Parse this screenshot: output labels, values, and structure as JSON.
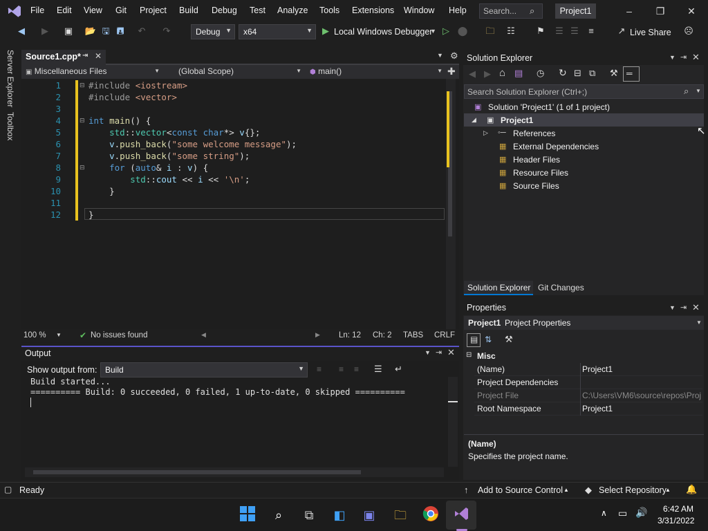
{
  "menu": {
    "items": [
      "File",
      "Edit",
      "View",
      "Git",
      "Project",
      "Build",
      "Debug",
      "Test",
      "Analyze",
      "Tools",
      "Extensions",
      "Window",
      "Help"
    ],
    "search_placeholder": "Search...",
    "project_name": "Project1"
  },
  "toolbar": {
    "configuration": "Debug",
    "platform": "x64",
    "run_label": "Local Windows Debugger",
    "live_share": "Live Share"
  },
  "left_strip": {
    "server_explorer": "Server Explorer",
    "toolbox": "Toolbox"
  },
  "editor": {
    "tab_label": "Source1.cpp*",
    "nav_file": "Miscellaneous Files",
    "nav_scope": "(Global Scope)",
    "nav_func": "main()",
    "line_numbers": [
      "1",
      "2",
      "3",
      "4",
      "5",
      "6",
      "7",
      "8",
      "9",
      "10",
      "11",
      "12"
    ],
    "zoom": "100 %",
    "issues": "No issues found",
    "ln": "Ln: 12",
    "ch": "Ch: 2",
    "tabs": "TABS",
    "eol": "CRLF"
  },
  "code_lines": {
    "l1a": "#include ",
    "l1b": "<iostream>",
    "l2a": "#include ",
    "l2b": "<vector>",
    "l4a": "int",
    "l4b": " main",
    "l4c": "() {",
    "l5a": "    std",
    "l5b": "::",
    "l5c": "vector",
    "l5d": "<",
    "l5e": "const char",
    "l5f": "*> ",
    "l5g": "v",
    "l5h": "{};",
    "l6a": "    v",
    "l6b": ".",
    "l6c": "push_back",
    "l6d": "(",
    "l6e": "\"some welcome message\"",
    "l6f": ");",
    "l7a": "    v",
    "l7b": ".",
    "l7c": "push_back",
    "l7d": "(",
    "l7e": "\"some string\"",
    "l7f": ");",
    "l8a": "    for",
    "l8b": " (",
    "l8c": "auto",
    "l8d": "& ",
    "l8e": "i",
    "l8f": " : ",
    "l8g": "v",
    "l8h": ") {",
    "l9a": "        std",
    "l9b": "::",
    "l9c": "cout",
    "l9d": " << ",
    "l9e": "i",
    "l9f": " << ",
    "l9g": "'\\n'",
    "l9h": ";",
    "l10": "    }",
    "l12": "}"
  },
  "output": {
    "title": "Output",
    "show_from_label": "Show output from:",
    "source": "Build",
    "line1": "Build started...",
    "line2": "========== Build: 0 succeeded, 0 failed, 1 up-to-date, 0 skipped =========="
  },
  "solution_explorer": {
    "title": "Solution Explorer",
    "search_placeholder": "Search Solution Explorer (Ctrl+;)",
    "solution": "Solution 'Project1' (1 of 1 project)",
    "project": "Project1",
    "items": [
      "References",
      "External Dependencies",
      "Header Files",
      "Resource Files",
      "Source Files"
    ],
    "tab_solution": "Solution Explorer",
    "tab_git": "Git Changes"
  },
  "properties": {
    "title": "Properties",
    "object": "Project1",
    "object_type": "Project Properties",
    "category": "Misc",
    "rows": [
      {
        "name": "(Name)",
        "value": "Project1"
      },
      {
        "name": "Project Dependencies",
        "value": ""
      },
      {
        "name": "Project File",
        "value": "C:\\Users\\VM6\\source\\repos\\Proj"
      },
      {
        "name": "Root Namespace",
        "value": "Project1"
      }
    ],
    "desc_title": "(Name)",
    "desc_text": "Specifies the project name."
  },
  "statusbar": {
    "ready": "Ready",
    "source_control": "Add to Source Control",
    "repository": "Select Repository"
  },
  "taskbar": {
    "time": "6:42 AM",
    "date": "3/31/2022"
  }
}
